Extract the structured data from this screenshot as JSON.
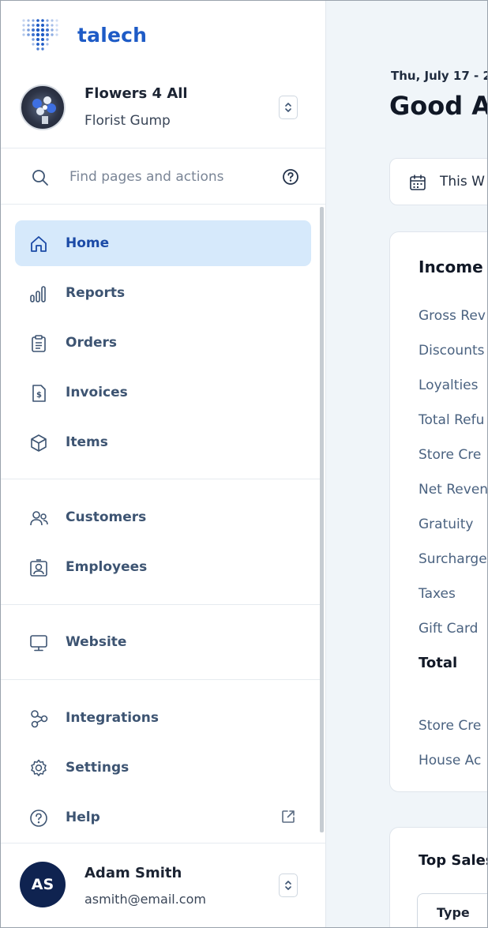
{
  "brand": {
    "name": "talech"
  },
  "business": {
    "name": "Flowers 4 All",
    "subtitle": "Florist Gump"
  },
  "search": {
    "placeholder": "Find pages and actions"
  },
  "nav": {
    "home": "Home",
    "reports": "Reports",
    "orders": "Orders",
    "invoices": "Invoices",
    "items": "Items",
    "customers": "Customers",
    "employees": "Employees",
    "website": "Website",
    "integrations": "Integrations",
    "settings": "Settings",
    "help": "Help"
  },
  "user": {
    "initials": "AS",
    "name": "Adam Smith",
    "email": "asmith@email.com"
  },
  "main": {
    "date": "Thu, July 17 - 2",
    "greeting": "Good A",
    "range_label": "This W",
    "income": {
      "title": "Income",
      "rows": [
        "Gross Rev",
        "Discounts",
        "Loyalties",
        "Total Refu",
        "Store Cre",
        "Net Reven",
        "Gratuity",
        "Surcharge",
        "Taxes",
        "Gift Card",
        "Total",
        "Store Cre",
        "House Ac"
      ]
    },
    "top_sales": {
      "title": "Top Sales",
      "type_header": "Type"
    }
  },
  "colors": {
    "accent": "#1e5bc6",
    "active_bg": "#d6e9fb",
    "nav_text": "#3d5472",
    "avatar_bg": "#0f2350"
  }
}
